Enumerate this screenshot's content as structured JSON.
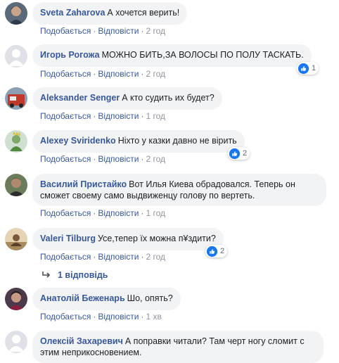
{
  "actions": {
    "like_label": "Подобається",
    "reply_label": "Відповісти",
    "separator": "·"
  },
  "comments": [
    {
      "author": "Sveta Zaharova",
      "text": "А хочется верить!",
      "time": "2 год",
      "reactions": null
    },
    {
      "author": "Игорь Рогожа",
      "text": "МОЖНО БИТЬ,ЗА ВОЛОСЫ ПО ПОЛУ ТАСКАТЬ.",
      "time": "2 год",
      "reactions": "1"
    },
    {
      "author": "Aleksander Senger",
      "text": "А кто судить их будет?",
      "time": "1 год",
      "reactions": null
    },
    {
      "author": "Alexey Sviridenko",
      "text": "Ніхто у казки давно не вірить",
      "time": "2 год",
      "reactions": "2"
    },
    {
      "author": "Василий Пристайко",
      "text": "Вот Илья Киева обрадовался. Теперь он сможет своему само выдвиженцу голову по вертеть.",
      "time": "1 год",
      "reactions": null
    },
    {
      "author": "Valeri Tilburg",
      "text": "Усе,тепер їх можна п¥здити?",
      "time": "2 год",
      "reactions": "2"
    },
    {
      "author": "Анатолій Беженарь",
      "text": "Шо, опять?",
      "time": "1 хв",
      "reactions": null
    },
    {
      "author": "Олексій Захаревич",
      "text": "А поправки читали? Там черт ногу сломит с этим неприкосновением.",
      "time": "",
      "reactions": null
    }
  ],
  "replies_link": "1 відповідь",
  "colors": {
    "bubble": "#f2f3f5",
    "author": "#385898",
    "like_blue": "#1877f2",
    "meta_gray": "#606770"
  },
  "icons": [
    "like-icon",
    "reply-arrow-icon",
    "avatar"
  ]
}
